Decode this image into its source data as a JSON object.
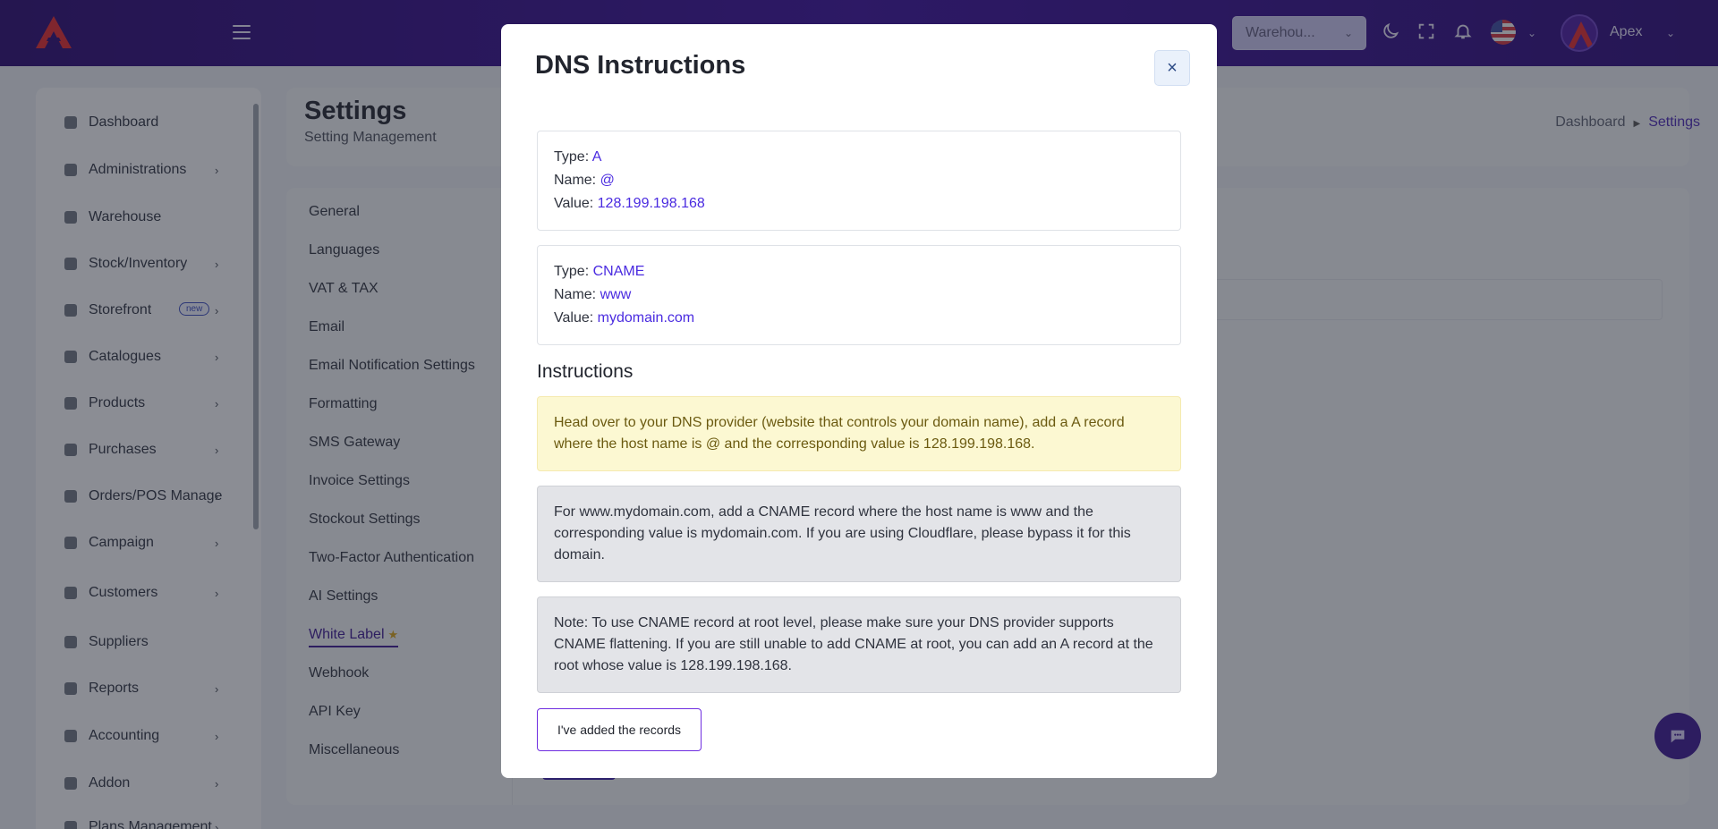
{
  "header": {
    "warehouse_select": "Warehou...",
    "user_name": "Apex"
  },
  "sidebar": {
    "items": [
      {
        "label": "Dashboard",
        "icon": "dashboard-icon",
        "chevron": false
      },
      {
        "label": "Administrations",
        "icon": "user-admin-icon",
        "chevron": true
      },
      {
        "label": "Warehouse",
        "icon": "warehouse-icon",
        "chevron": false
      },
      {
        "label": "Stock/Inventory",
        "icon": "inventory-icon",
        "chevron": true
      },
      {
        "label": "Storefront",
        "icon": "storefront-icon",
        "chevron": true,
        "badge": "new"
      },
      {
        "label": "Catalogues",
        "icon": "catalogue-icon",
        "chevron": true
      },
      {
        "label": "Products",
        "icon": "products-icon",
        "chevron": true
      },
      {
        "label": "Purchases",
        "icon": "purchases-icon",
        "chevron": true
      },
      {
        "label": "Orders/POS Manage",
        "icon": "orders-icon",
        "chevron": true
      },
      {
        "label": "Campaign",
        "icon": "campaign-icon",
        "chevron": true
      },
      {
        "label": "Customers",
        "icon": "customers-icon",
        "chevron": true
      },
      {
        "label": "Suppliers",
        "icon": "suppliers-icon",
        "chevron": false
      },
      {
        "label": "Reports",
        "icon": "reports-icon",
        "chevron": true
      },
      {
        "label": "Accounting",
        "icon": "accounting-icon",
        "chevron": true
      },
      {
        "label": "Addon",
        "icon": "addon-icon",
        "chevron": true
      },
      {
        "label": "Plans Management",
        "icon": "plans-icon",
        "chevron": true
      }
    ]
  },
  "page": {
    "title": "Settings",
    "subtitle": "Setting Management",
    "breadcrumb": [
      "Dashboard",
      "Settings"
    ]
  },
  "settings_nav": [
    {
      "label": "General"
    },
    {
      "label": "Languages"
    },
    {
      "label": "VAT & TAX"
    },
    {
      "label": "Email"
    },
    {
      "label": "Email Notification Settings"
    },
    {
      "label": "Formatting"
    },
    {
      "label": "SMS Gateway"
    },
    {
      "label": "Invoice Settings"
    },
    {
      "label": "Stockout Settings"
    },
    {
      "label": "Two-Factor Authentication"
    },
    {
      "label": "AI Settings"
    },
    {
      "label": "White Label",
      "active": true
    },
    {
      "label": "Webhook"
    },
    {
      "label": "API Key"
    },
    {
      "label": "Miscellaneous"
    }
  ],
  "modal": {
    "title": "DNS Instructions",
    "close_symbol": "×",
    "records": [
      {
        "type_label": "Type:",
        "type": "A",
        "name_label": "Name:",
        "name": "@",
        "value_label": "Value:",
        "value": "128.199.198.168"
      },
      {
        "type_label": "Type:",
        "type": "CNAME",
        "name_label": "Name:",
        "name": "www",
        "value_label": "Value:",
        "value": "mydomain.com"
      }
    ],
    "instructions_heading": "Instructions",
    "instruction_a": "Head over to your DNS provider (website that controls your domain name), add a A record where the host name is @ and the corresponding value is 128.199.198.168.",
    "instruction_cname": "For www.mydomain.com, add a CNAME record where the host name is www and the corresponding value is mydomain.com. If you are using Cloudflare, please bypass it for this domain.",
    "instruction_note": "Note: To use CNAME record at root level, please make sure your DNS provider supports CNAME flattening. If you are still unable to add CNAME at root, you can add an A record at the root whose value is 128.199.198.168.",
    "confirm_button": "I've added the records"
  },
  "colors": {
    "header": "#3a0e9a",
    "accent": "#4a2be0",
    "alert_yellow": "#fcf8d2",
    "alert_gray": "#e3e4e8"
  }
}
